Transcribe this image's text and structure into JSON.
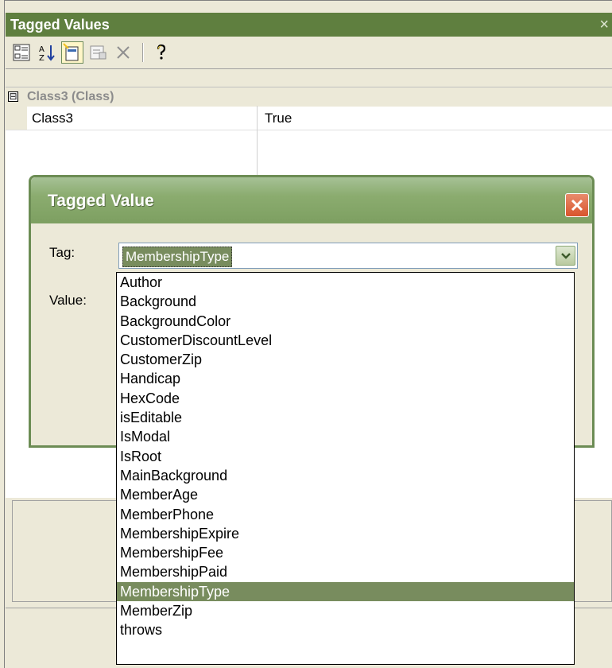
{
  "window": {
    "title": "Tagged Values",
    "close_glyph": "×"
  },
  "toolbar": {
    "buttons": [
      {
        "icon": "categorized-icon"
      },
      {
        "icon": "sort-alpha-icon"
      },
      {
        "icon": "new-tag-icon"
      },
      {
        "icon": "properties-icon"
      },
      {
        "icon": "delete-icon"
      },
      {
        "icon": "help-icon"
      }
    ]
  },
  "grid": {
    "group": {
      "expander": "⊟",
      "label": "Class3 (Class)"
    },
    "rows": [
      {
        "name": "Class3",
        "value": "True"
      }
    ]
  },
  "dialog": {
    "title": "Tagged Value",
    "tag_label": "Tag:",
    "value_label": "Value:",
    "tag_selected": "MembershipType",
    "options": [
      "Author",
      "Background",
      "BackgroundColor",
      "CustomerDiscountLevel",
      "CustomerZip",
      "Handicap",
      "HexCode",
      "isEditable",
      "IsModal",
      "IsRoot",
      "MainBackground",
      "MemberAge",
      "MemberPhone",
      "MembershipExpire",
      "MembershipFee",
      "MembershipPaid",
      "MembershipType",
      "MemberZip",
      "throws"
    ],
    "selected_index": 16
  },
  "colors": {
    "titlebar": "#5f7f3f",
    "selection": "#788c5e",
    "dialog_title": "#8bac6f"
  }
}
